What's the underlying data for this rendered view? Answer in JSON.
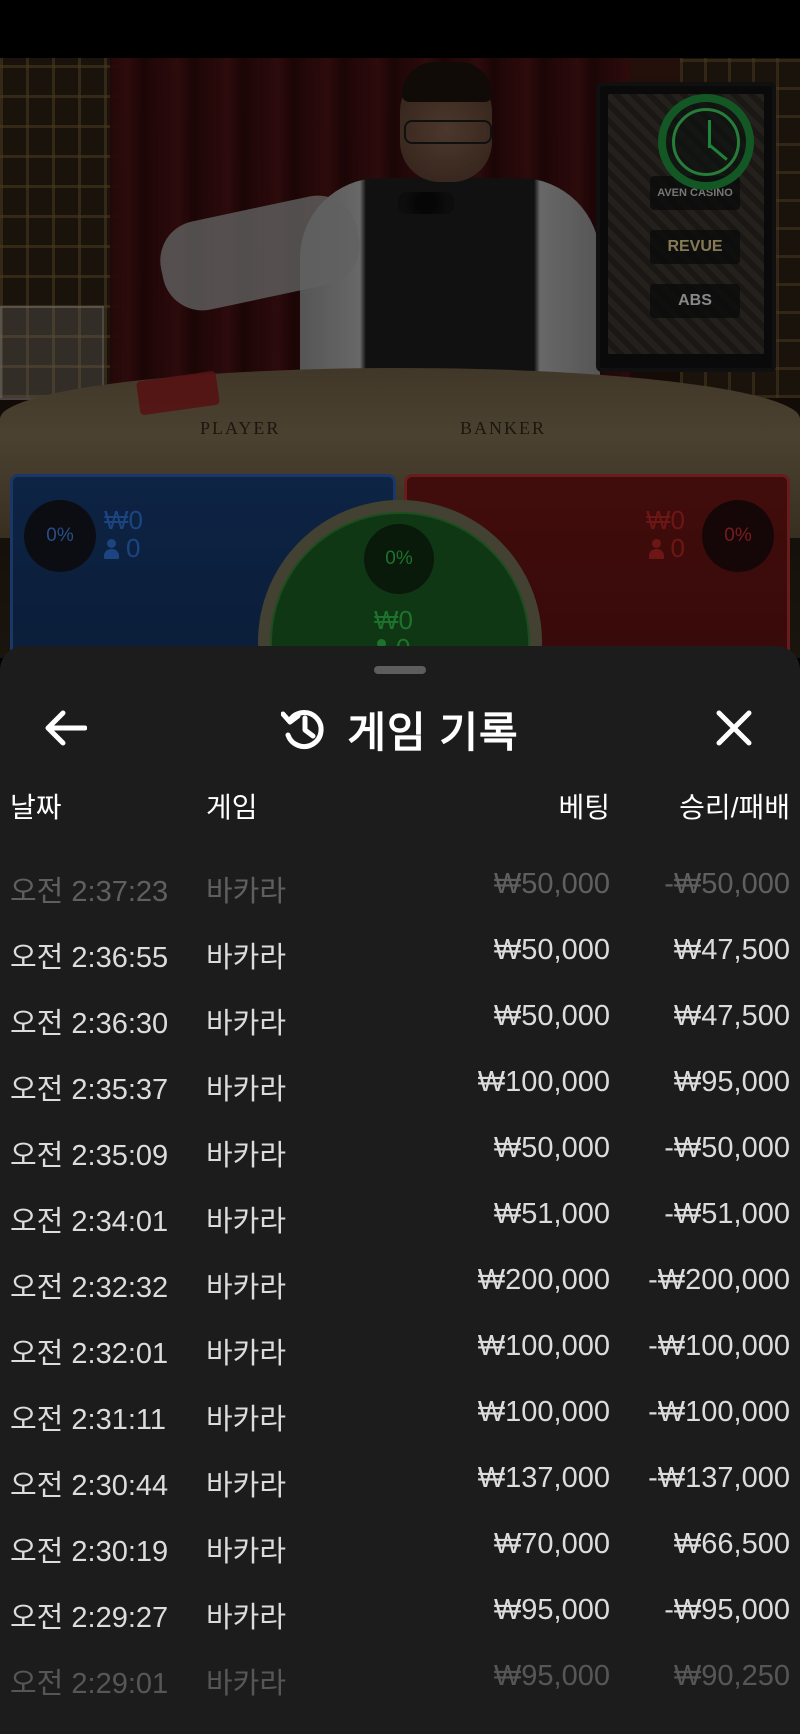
{
  "stream": {
    "table_labels": {
      "player": "PLAYER",
      "banker": "BANKER"
    },
    "monitor_logos": [
      "AVEN CASINO",
      "REVUE",
      "ABS"
    ],
    "timer_fraction": 0.92
  },
  "bets": {
    "player": {
      "percent": "0%",
      "amount": "₩0",
      "players": "0"
    },
    "tie": {
      "percent": "0%",
      "amount": "₩0",
      "players": "0"
    },
    "banker": {
      "percent": "0%",
      "amount": "₩0",
      "players": "0"
    }
  },
  "history_panel": {
    "title": "게임 기록",
    "columns": {
      "date": "날짜",
      "game": "게임",
      "bet": "베팅",
      "result": "승리/패배"
    },
    "rows": [
      {
        "time": "오전 2:37:23",
        "game": "바카라",
        "bet": "₩50,000",
        "result": "-₩50,000"
      },
      {
        "time": "오전 2:36:55",
        "game": "바카라",
        "bet": "₩50,000",
        "result": "₩47,500"
      },
      {
        "time": "오전 2:36:30",
        "game": "바카라",
        "bet": "₩50,000",
        "result": "₩47,500"
      },
      {
        "time": "오전 2:35:37",
        "game": "바카라",
        "bet": "₩100,000",
        "result": "₩95,000"
      },
      {
        "time": "오전 2:35:09",
        "game": "바카라",
        "bet": "₩50,000",
        "result": "-₩50,000"
      },
      {
        "time": "오전 2:34:01",
        "game": "바카라",
        "bet": "₩51,000",
        "result": "-₩51,000"
      },
      {
        "time": "오전 2:32:32",
        "game": "바카라",
        "bet": "₩200,000",
        "result": "-₩200,000"
      },
      {
        "time": "오전 2:32:01",
        "game": "바카라",
        "bet": "₩100,000",
        "result": "-₩100,000"
      },
      {
        "time": "오전 2:31:11",
        "game": "바카라",
        "bet": "₩100,000",
        "result": "-₩100,000"
      },
      {
        "time": "오전 2:30:44",
        "game": "바카라",
        "bet": "₩137,000",
        "result": "-₩137,000"
      },
      {
        "time": "오전 2:30:19",
        "game": "바카라",
        "bet": "₩70,000",
        "result": "₩66,500"
      },
      {
        "time": "오전 2:29:27",
        "game": "바카라",
        "bet": "₩95,000",
        "result": "-₩95,000"
      },
      {
        "time": "오전 2:29:01",
        "game": "바카라",
        "bet": "₩95,000",
        "result": "₩90,250"
      }
    ]
  },
  "colors": {
    "player_blue": "#2d6fd0",
    "banker_red": "#b02525",
    "tie_green": "#2fb84a",
    "panel_bg": "#1c1c1c",
    "timer_green": "#2fd35c"
  },
  "icons": {
    "back": "arrow-left-icon",
    "history": "history-clock-icon",
    "close": "close-icon",
    "user": "user-icon",
    "timer": "round-timer-icon"
  }
}
